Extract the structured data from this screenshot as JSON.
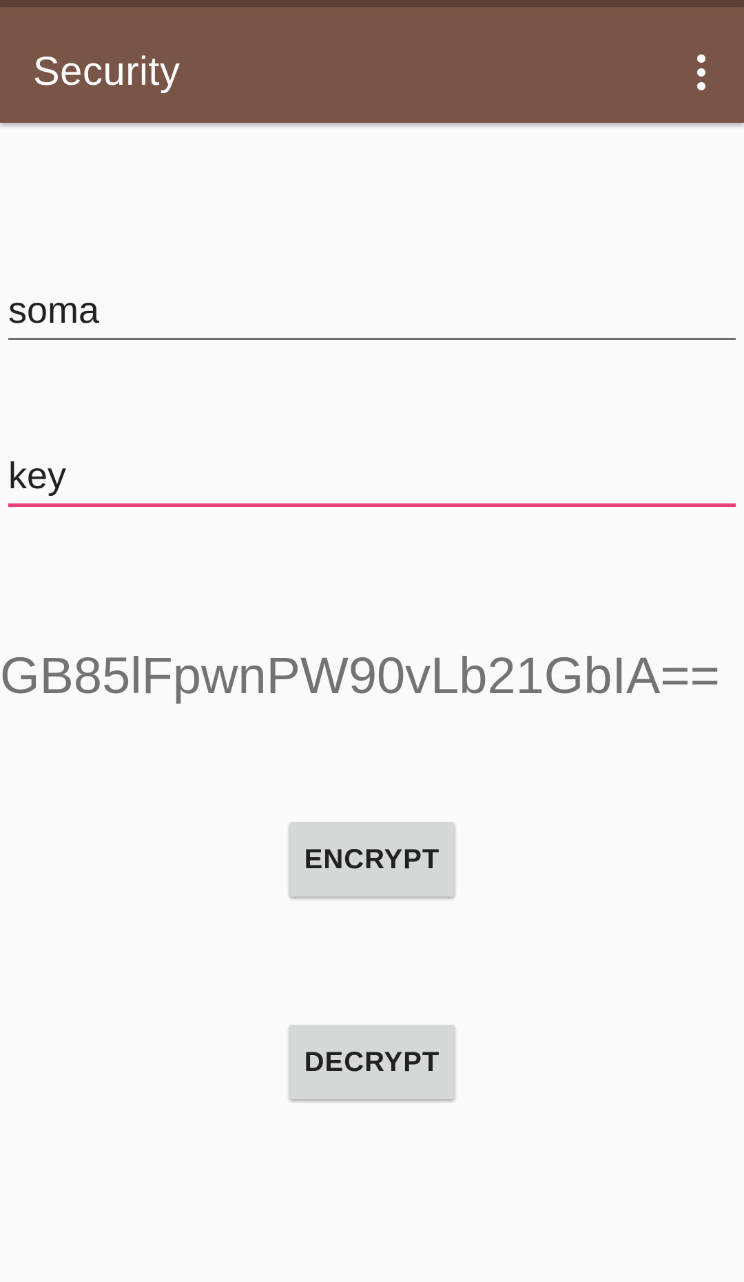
{
  "app_bar": {
    "title": "Security",
    "overflow_icon": "more-vert-icon",
    "background_color": "#795548",
    "status_bar_color": "#5d4037"
  },
  "form": {
    "message_value": "soma",
    "key_value": "key",
    "focused_field_color": "#ec407a"
  },
  "result": {
    "text": "GB85lFpwnPW90vLb21GbIA=="
  },
  "buttons": {
    "encrypt_label": "ENCRYPT",
    "decrypt_label": "DECRYPT"
  }
}
